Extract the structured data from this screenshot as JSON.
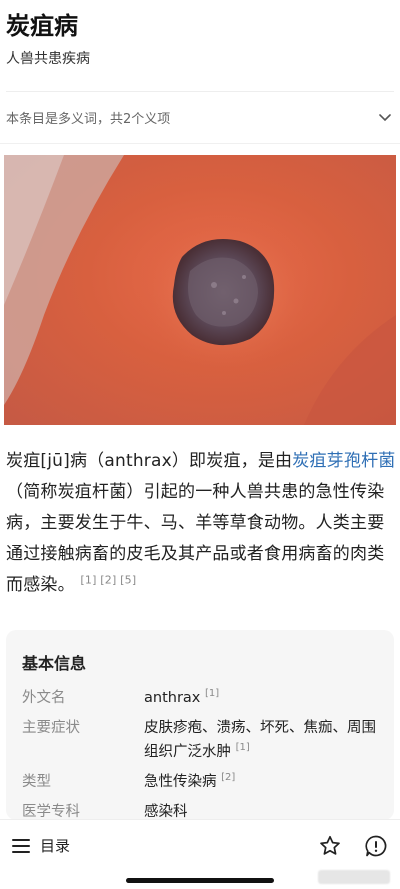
{
  "header": {
    "title": "炭疽病",
    "subtitle": "人兽共患疾病"
  },
  "disambiguation": {
    "text": "本条目是多义词，共2个义项"
  },
  "hero_image": {
    "icon": "lesion-photo"
  },
  "intro": {
    "part1": "炭疽[jū]病（anthrax）即炭疽，是由",
    "link": "炭疽芽孢杆菌",
    "part2": "（简称炭疽杆菌）引起的一种人兽共患的急性传染病，主要发生于牛、马、羊等草食动物。人类主要通过接触病畜的皮毛及其产品或者食用病畜的肉类而感染。",
    "refs": "[1] [2] [5]"
  },
  "infobox": {
    "title": "基本信息",
    "rows": [
      {
        "label": "外文名",
        "value": "anthrax",
        "ref": "[1]"
      },
      {
        "label": "主要症状",
        "value": "皮肤疹疱、溃疡、坏死、焦痂、周围组织广泛水肿",
        "ref": "[1]"
      },
      {
        "label": "类型",
        "value": "急性传染病",
        "ref": "[2]"
      },
      {
        "label": "医学专科",
        "value": "感染科",
        "ref": ""
      }
    ]
  },
  "toolbar": {
    "toc_label": "目录",
    "icons": [
      "menu-icon",
      "star-icon",
      "report-icon"
    ]
  },
  "colors": {
    "link": "#2f6fb5",
    "infobox_bg": "#f6f6f6"
  }
}
